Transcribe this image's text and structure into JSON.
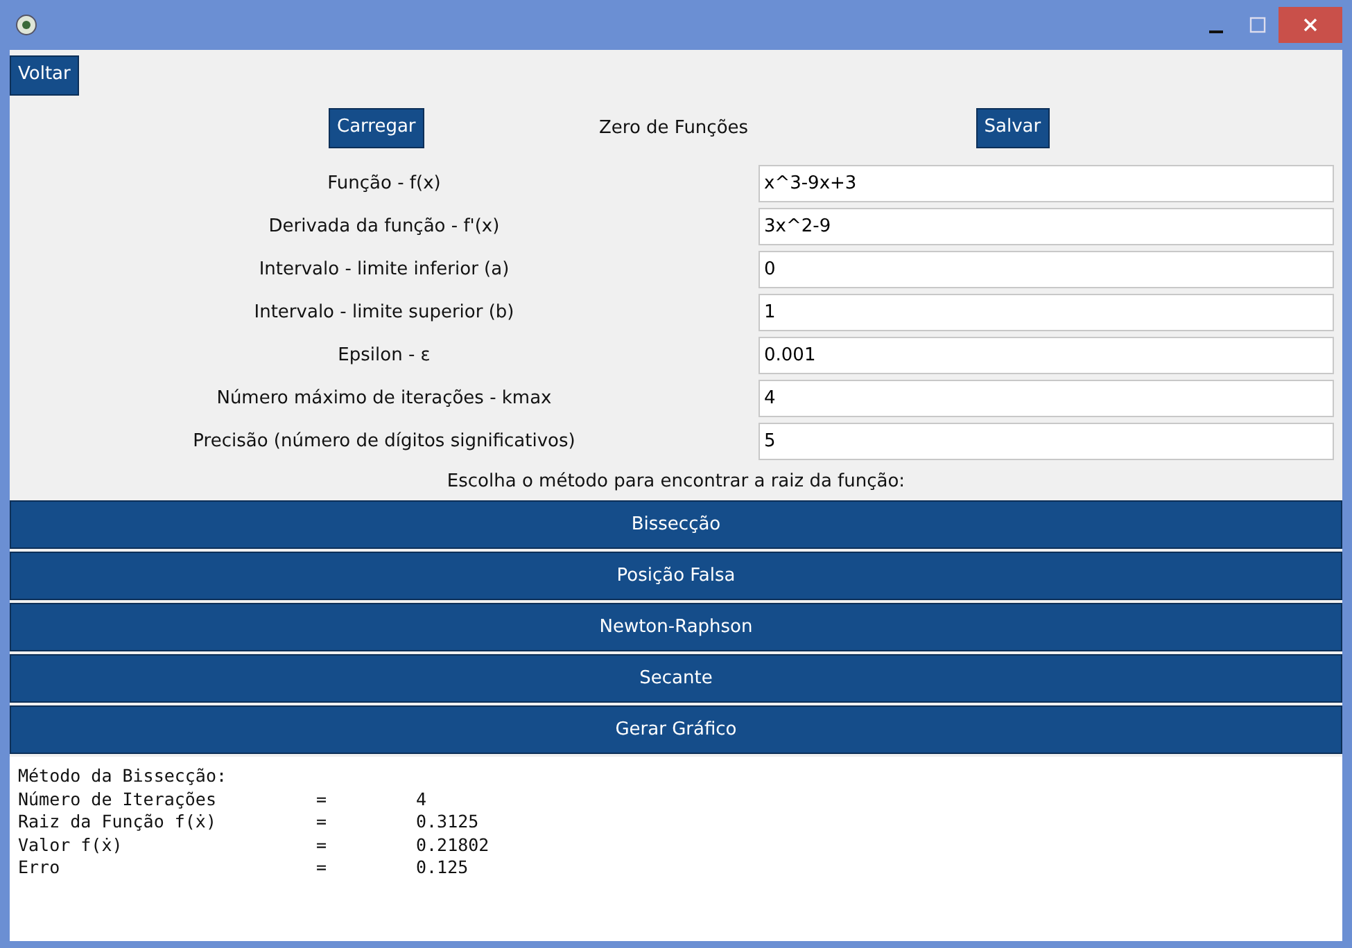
{
  "back_button": "Voltar",
  "header": {
    "load_button": "Carregar",
    "title": "Zero de Funções",
    "save_button": "Salvar"
  },
  "fields": [
    {
      "label": "Função - f(x)",
      "value": "x^3-9x+3"
    },
    {
      "label": "Derivada da função - f'(x)",
      "value": "3x^2-9"
    },
    {
      "label": "Intervalo - limite inferior (a)",
      "value": "0"
    },
    {
      "label": "Intervalo - limite superior (b)",
      "value": "1"
    },
    {
      "label": "Epsilon - ε",
      "value": "0.001"
    },
    {
      "label": "Número máximo de iterações - kmax",
      "value": "4"
    },
    {
      "label": "Precisão (número de dígitos significativos)",
      "value": "5"
    }
  ],
  "method_prompt": "Escolha o método para encontrar a raiz da função:",
  "method_buttons": [
    "Bissecção",
    "Posição Falsa",
    "Newton-Raphson",
    "Secante",
    "Gerar Gráfico"
  ],
  "output": {
    "heading": "Método da Bissecção:",
    "rows": [
      {
        "label": "Número de Iterações",
        "sign": "=",
        "value": "4"
      },
      {
        "label": "Raiz da Função f(ẋ)",
        "sign": "=",
        "value": "0.3125"
      },
      {
        "label": "Valor f(ẋ)",
        "sign": "=",
        "value": "0.21802"
      },
      {
        "label": "Erro",
        "sign": "=",
        "value": "0.125"
      }
    ]
  }
}
